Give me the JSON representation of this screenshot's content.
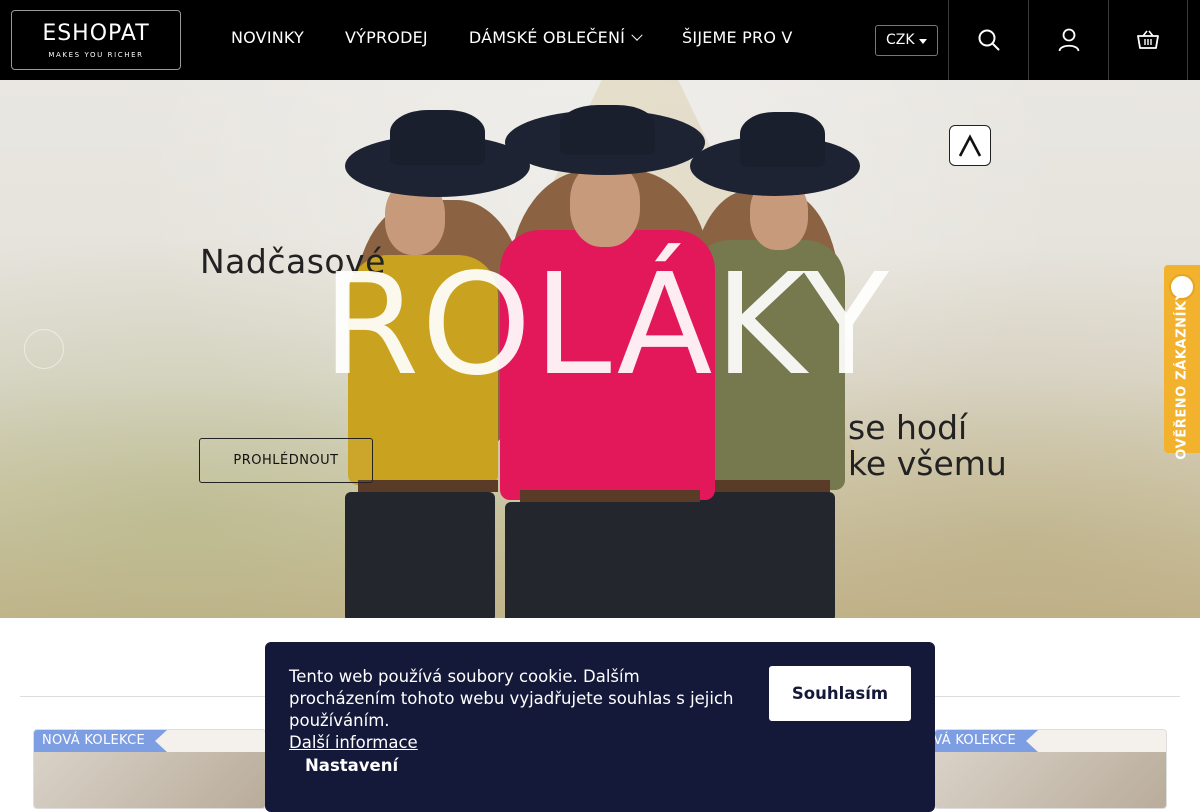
{
  "header": {
    "logo_main": "ESHOPAT",
    "logo_sub": "MAKES YOU RICHER",
    "nav": [
      {
        "label": "NOVINKY"
      },
      {
        "label": "VÝPRODEJ"
      },
      {
        "label": "DÁMSKÉ OBLEČENÍ"
      },
      {
        "label": "ŠIJEME PRO V"
      }
    ],
    "currency": "CZK"
  },
  "hero": {
    "tagline": "Nadčasové",
    "headline": "ROLÁKY",
    "sub_line1": "se hodí",
    "sub_line2": "ke všemu",
    "button": "PROHLÉDNOUT"
  },
  "verified_tab": "OVĚŘENO ZÁKAZNÍKY",
  "products": [
    {
      "badge": "NOVÁ KOLEKCE"
    },
    {
      "badge": "NOVÁ KOLEKCE"
    }
  ],
  "cookie": {
    "text": "Tento web používá soubory cookie. Dalším procházením tohoto webu vyjadřujete souhlas s jejich používáním.",
    "more_link": "Další informace",
    "accept": "Souhlasím",
    "settings": "Nastavení"
  },
  "colors": {
    "header_bg": "#000000",
    "cookie_bg": "#14193a",
    "ribbon": "#7e9ee3",
    "verified": "#f2b22d"
  }
}
